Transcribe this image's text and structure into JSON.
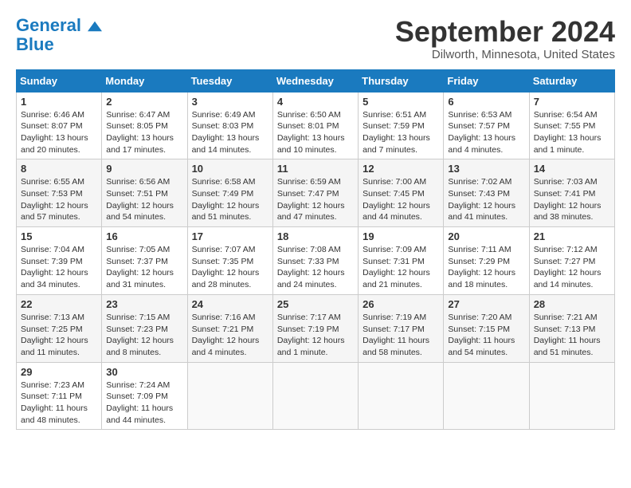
{
  "header": {
    "logo_line1": "General",
    "logo_line2": "Blue",
    "month_title": "September 2024",
    "subtitle": "Dilworth, Minnesota, United States"
  },
  "calendar": {
    "days_of_week": [
      "Sunday",
      "Monday",
      "Tuesday",
      "Wednesday",
      "Thursday",
      "Friday",
      "Saturday"
    ],
    "weeks": [
      [
        null,
        {
          "day": "2",
          "sunrise": "6:47 AM",
          "sunset": "8:05 PM",
          "daylight": "13 hours and 17 minutes."
        },
        {
          "day": "3",
          "sunrise": "6:49 AM",
          "sunset": "8:03 PM",
          "daylight": "13 hours and 14 minutes."
        },
        {
          "day": "4",
          "sunrise": "6:50 AM",
          "sunset": "8:01 PM",
          "daylight": "13 hours and 10 minutes."
        },
        {
          "day": "5",
          "sunrise": "6:51 AM",
          "sunset": "7:59 PM",
          "daylight": "13 hours and 7 minutes."
        },
        {
          "day": "6",
          "sunrise": "6:53 AM",
          "sunset": "7:57 PM",
          "daylight": "13 hours and 4 minutes."
        },
        {
          "day": "7",
          "sunrise": "6:54 AM",
          "sunset": "7:55 PM",
          "daylight": "13 hours and 1 minute."
        }
      ],
      [
        {
          "day": "1",
          "sunrise": "6:46 AM",
          "sunset": "8:07 PM",
          "daylight": "13 hours and 20 minutes."
        },
        null,
        null,
        null,
        null,
        null,
        null
      ],
      [
        {
          "day": "8",
          "sunrise": "6:55 AM",
          "sunset": "7:53 PM",
          "daylight": "12 hours and 57 minutes."
        },
        {
          "day": "9",
          "sunrise": "6:56 AM",
          "sunset": "7:51 PM",
          "daylight": "12 hours and 54 minutes."
        },
        {
          "day": "10",
          "sunrise": "6:58 AM",
          "sunset": "7:49 PM",
          "daylight": "12 hours and 51 minutes."
        },
        {
          "day": "11",
          "sunrise": "6:59 AM",
          "sunset": "7:47 PM",
          "daylight": "12 hours and 47 minutes."
        },
        {
          "day": "12",
          "sunrise": "7:00 AM",
          "sunset": "7:45 PM",
          "daylight": "12 hours and 44 minutes."
        },
        {
          "day": "13",
          "sunrise": "7:02 AM",
          "sunset": "7:43 PM",
          "daylight": "12 hours and 41 minutes."
        },
        {
          "day": "14",
          "sunrise": "7:03 AM",
          "sunset": "7:41 PM",
          "daylight": "12 hours and 38 minutes."
        }
      ],
      [
        {
          "day": "15",
          "sunrise": "7:04 AM",
          "sunset": "7:39 PM",
          "daylight": "12 hours and 34 minutes."
        },
        {
          "day": "16",
          "sunrise": "7:05 AM",
          "sunset": "7:37 PM",
          "daylight": "12 hours and 31 minutes."
        },
        {
          "day": "17",
          "sunrise": "7:07 AM",
          "sunset": "7:35 PM",
          "daylight": "12 hours and 28 minutes."
        },
        {
          "day": "18",
          "sunrise": "7:08 AM",
          "sunset": "7:33 PM",
          "daylight": "12 hours and 24 minutes."
        },
        {
          "day": "19",
          "sunrise": "7:09 AM",
          "sunset": "7:31 PM",
          "daylight": "12 hours and 21 minutes."
        },
        {
          "day": "20",
          "sunrise": "7:11 AM",
          "sunset": "7:29 PM",
          "daylight": "12 hours and 18 minutes."
        },
        {
          "day": "21",
          "sunrise": "7:12 AM",
          "sunset": "7:27 PM",
          "daylight": "12 hours and 14 minutes."
        }
      ],
      [
        {
          "day": "22",
          "sunrise": "7:13 AM",
          "sunset": "7:25 PM",
          "daylight": "12 hours and 11 minutes."
        },
        {
          "day": "23",
          "sunrise": "7:15 AM",
          "sunset": "7:23 PM",
          "daylight": "12 hours and 8 minutes."
        },
        {
          "day": "24",
          "sunrise": "7:16 AM",
          "sunset": "7:21 PM",
          "daylight": "12 hours and 4 minutes."
        },
        {
          "day": "25",
          "sunrise": "7:17 AM",
          "sunset": "7:19 PM",
          "daylight": "12 hours and 1 minute."
        },
        {
          "day": "26",
          "sunrise": "7:19 AM",
          "sunset": "7:17 PM",
          "daylight": "11 hours and 58 minutes."
        },
        {
          "day": "27",
          "sunrise": "7:20 AM",
          "sunset": "7:15 PM",
          "daylight": "11 hours and 54 minutes."
        },
        {
          "day": "28",
          "sunrise": "7:21 AM",
          "sunset": "7:13 PM",
          "daylight": "11 hours and 51 minutes."
        }
      ],
      [
        {
          "day": "29",
          "sunrise": "7:23 AM",
          "sunset": "7:11 PM",
          "daylight": "11 hours and 48 minutes."
        },
        {
          "day": "30",
          "sunrise": "7:24 AM",
          "sunset": "7:09 PM",
          "daylight": "11 hours and 44 minutes."
        },
        null,
        null,
        null,
        null,
        null
      ]
    ]
  }
}
